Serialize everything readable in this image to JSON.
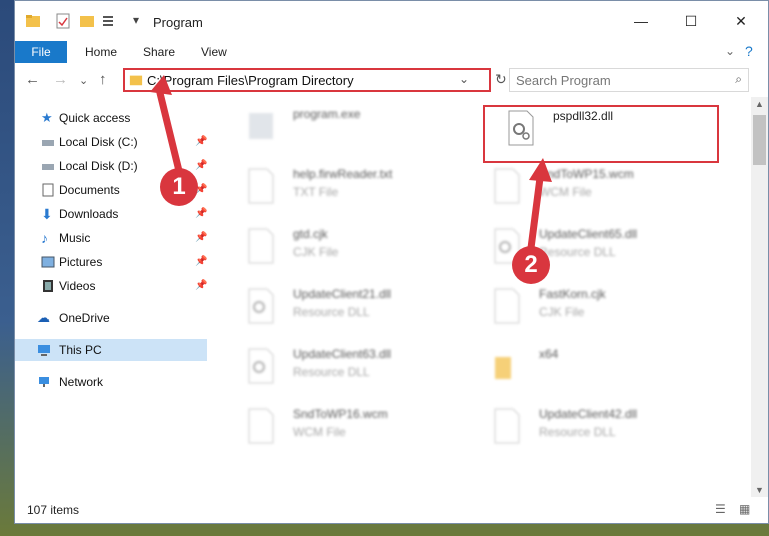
{
  "window": {
    "title": "Program"
  },
  "ribbon": {
    "tabs": [
      "File",
      "Home",
      "Share",
      "View"
    ]
  },
  "nav": {
    "address": "C:\\Program Files\\Program Directory",
    "search_placeholder": "Search Program"
  },
  "sidebar": {
    "items": [
      {
        "label": "Quick access"
      },
      {
        "label": "Local Disk (C:)"
      },
      {
        "label": "Local Disk (D:)"
      },
      {
        "label": "Documents"
      },
      {
        "label": "Downloads"
      },
      {
        "label": "Music"
      },
      {
        "label": "Pictures"
      },
      {
        "label": "Videos"
      },
      {
        "label": "OneDrive"
      },
      {
        "label": "This PC"
      },
      {
        "label": "Network"
      }
    ]
  },
  "files": [
    {
      "name": "program.exe",
      "type": ""
    },
    {
      "name": "pspdll32.dll",
      "type": ""
    },
    {
      "name": "help.firwReader.txt",
      "type": "TXT File"
    },
    {
      "name": "SndToWP15.wcm",
      "type": "WCM File"
    },
    {
      "name": "gtd.cjk",
      "type": "CJK File"
    },
    {
      "name": "UpdateClient65.dll",
      "type": "Resource DLL"
    },
    {
      "name": "UpdateClient21.dll",
      "type": "Resource DLL"
    },
    {
      "name": "FastKorn.cjk",
      "type": "CJK File"
    },
    {
      "name": "UpdateClient63.dll",
      "type": "Resource DLL"
    },
    {
      "name": "x64",
      "type": ""
    },
    {
      "name": "SndToWP16.wcm",
      "type": "WCM File"
    },
    {
      "name": "UpdateClient42.dll",
      "type": "Resource DLL"
    }
  ],
  "annotations": {
    "badge1": "1",
    "badge2": "2"
  },
  "status": {
    "items": "107 items"
  },
  "colors": {
    "accent": "#1979ca",
    "highlight": "#d9363e"
  }
}
